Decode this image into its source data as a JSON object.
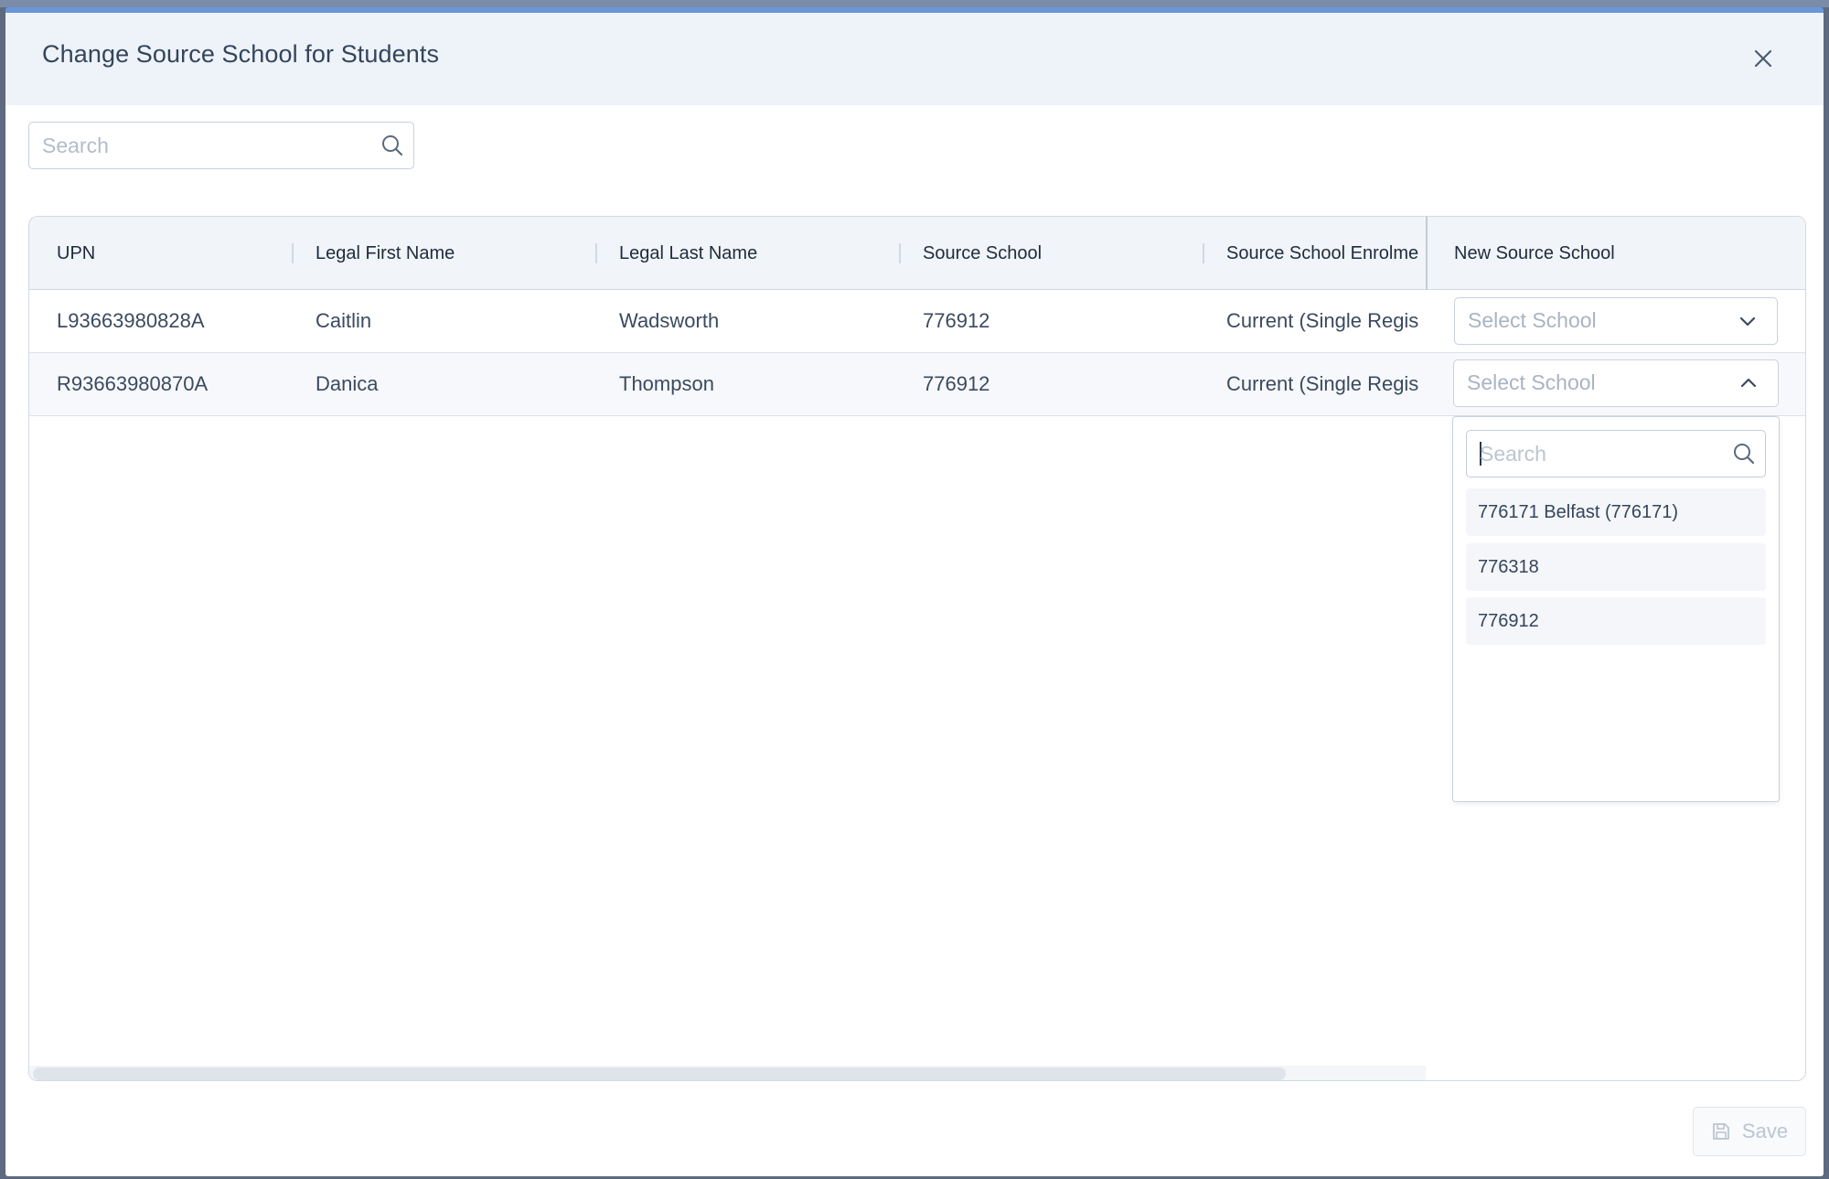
{
  "modal": {
    "title": "Change Source School for Students",
    "close_icon": "close-icon"
  },
  "search": {
    "placeholder": "Search",
    "icon": "search-icon"
  },
  "table": {
    "columns": [
      "UPN",
      "Legal First Name",
      "Legal Last Name",
      "Source School",
      "Source School Enrolme",
      "New Source School"
    ],
    "rows": [
      {
        "upn": "L93663980828A",
        "first_name": "Caitlin",
        "last_name": "Wadsworth",
        "source_school": "776912",
        "enrolment": "Current (Single Regis",
        "new_source_school_placeholder": "Select School"
      },
      {
        "upn": "R93663980870A",
        "first_name": "Danica",
        "last_name": "Thompson",
        "source_school": "776912",
        "enrolment": "Current (Single Regis",
        "new_source_school_placeholder": "Select School"
      }
    ]
  },
  "dropdown": {
    "search_placeholder": "Search",
    "options": [
      "776171 Belfast (776171)",
      "776318",
      "776912"
    ]
  },
  "footer": {
    "save_label": "Save",
    "save_icon": "save-icon"
  },
  "colors": {
    "accent": "#6a96da",
    "header_bg": "#eef3f9"
  }
}
